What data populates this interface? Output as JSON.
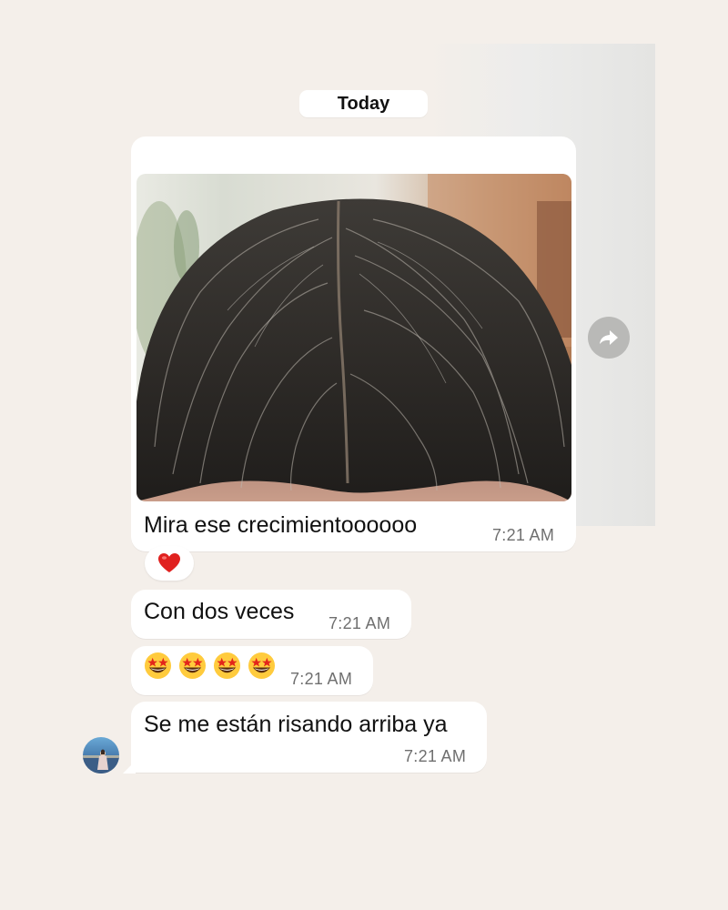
{
  "date_separator": "Today",
  "messages": [
    {
      "text": "Mira ese crecimientoooooo",
      "time": "7:21 AM",
      "has_photo": true,
      "reaction": "red-heart"
    },
    {
      "text": "Con dos veces",
      "time": "7:21 AM"
    },
    {
      "text": "",
      "emojis": [
        "star-struck",
        "star-struck",
        "star-struck",
        "star-struck"
      ],
      "time": "7:21 AM"
    },
    {
      "text": "Se me están risando arriba ya",
      "time": "7:21 AM"
    }
  ],
  "icons": {
    "forward": "forward-arrow-icon",
    "reaction": "red-heart-icon",
    "emoji": "star-struck-emoji"
  },
  "colors": {
    "background": "#f4efea",
    "bubble": "#ffffff",
    "timestamp": "#6f6f6f",
    "heart": "#e0211f"
  }
}
